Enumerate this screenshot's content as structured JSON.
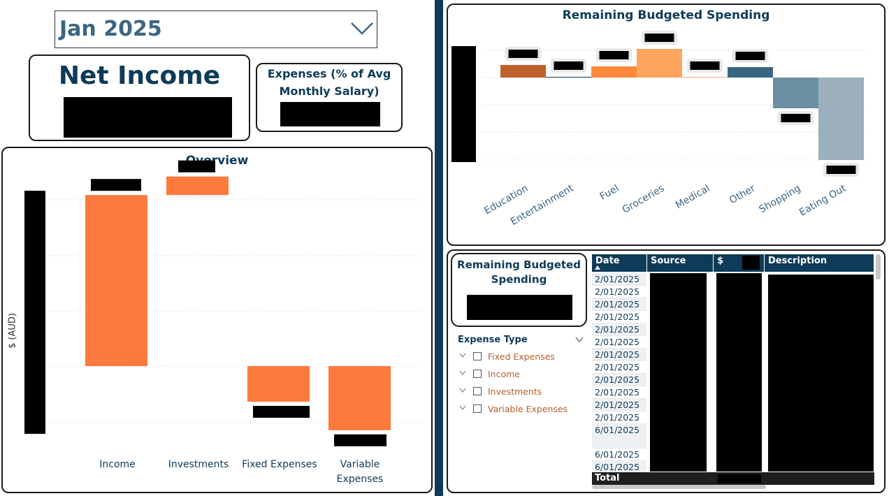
{
  "month_selector": {
    "value": "Jan 2025",
    "chevron_icon": "chevron-down-icon"
  },
  "net_income": {
    "title": "Net Income"
  },
  "expenses_pct": {
    "title_line1": "Expenses (% of Avg",
    "title_line2": "Monthly Salary)"
  },
  "remaining_card": {
    "title_line1": "Remaining Budgeted",
    "title_line2": "Spending"
  },
  "overview_chart": {
    "title": "Overview",
    "ylabel": "$ (AUD)"
  },
  "budget_chart": {
    "title": "Remaining Budgeted Spending"
  },
  "chart_data": [
    {
      "type": "bar",
      "title": "Overview",
      "ylabel": "$ (AUD)",
      "categories": [
        "Income",
        "Investments",
        "Fixed Expenses",
        "Variable Expenses"
      ],
      "values": [
        6000,
        650,
        -1250,
        -2250
      ],
      "note_waterfall": true
    },
    {
      "type": "bar",
      "title": "Remaining Budgeted Spending",
      "categories": [
        "Education",
        "Entertainment",
        "Fuel",
        "Groceries",
        "Medical",
        "Other",
        "Shopping",
        "Eating Out"
      ],
      "values": [
        18,
        1,
        16,
        41,
        1,
        15,
        -44,
        -118
      ],
      "colors": [
        "#c0602a",
        "#0e3b58",
        "#fd8a3c",
        "#fda45f",
        "#fcb07a",
        "#3b6683",
        "#6b8fa3",
        "#9bb0bc"
      ]
    }
  ],
  "table": {
    "headers": {
      "date": "Date",
      "source": "Source",
      "amount": "$",
      "description": "Description"
    },
    "dates": [
      "2/01/2025",
      "2/01/2025",
      "2/01/2025",
      "2/01/2025",
      "2/01/2025",
      "2/01/2025",
      "2/01/2025",
      "2/01/2025",
      "2/01/2025",
      "2/01/2025",
      "2/01/2025",
      "2/01/2025",
      "6/01/2025",
      "6/01/2025",
      "6/01/2025"
    ],
    "total_label": "Total",
    "sort_icon": "sort-ascending-icon"
  },
  "slicer": {
    "title": "Expense Type",
    "items": [
      "Fixed Expenses",
      "Income",
      "Investments",
      "Variable Expenses"
    ]
  }
}
